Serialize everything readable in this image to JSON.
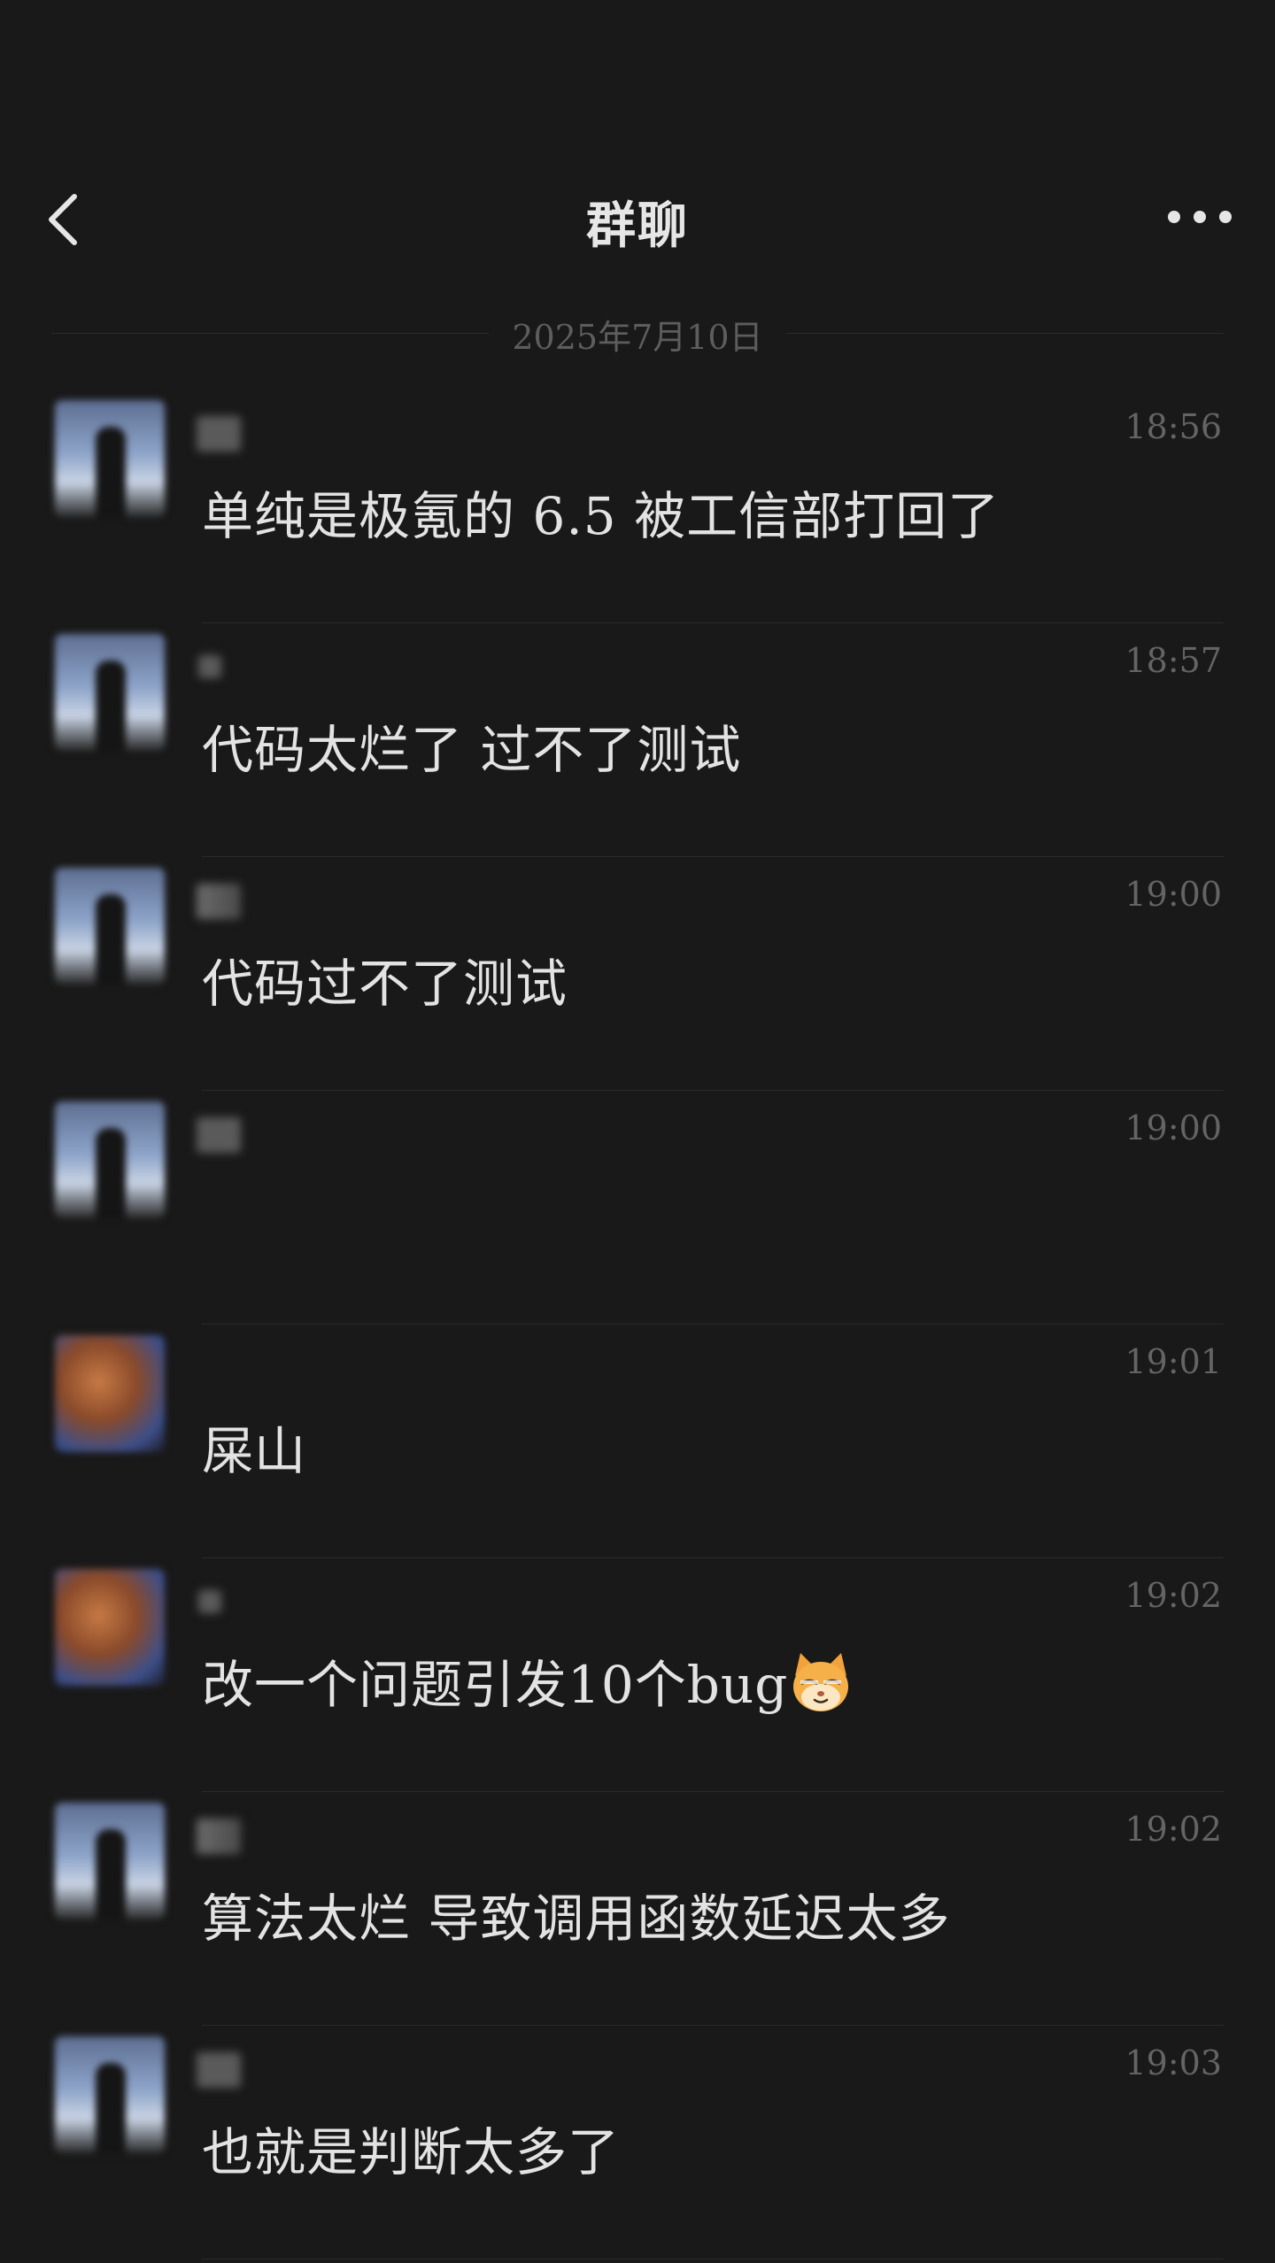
{
  "header": {
    "title": "群聊",
    "back_icon": "chevron-left-icon",
    "more_icon": "more-dots-icon"
  },
  "date_divider": "2025年7月10日",
  "messages": [
    {
      "time": "18:56",
      "text": "单纯是极氪的 6.5 被工信部打回了",
      "avatar": "sky",
      "sender_style": "normal"
    },
    {
      "time": "18:57",
      "text": "代码太烂了 过不了测试",
      "avatar": "sky",
      "sender_style": "small"
    },
    {
      "time": "19:00",
      "text": "代码过不了测试",
      "avatar": "sky",
      "sender_style": "half"
    },
    {
      "time": "19:00",
      "text": "",
      "avatar": "sky",
      "sender_style": "normal"
    },
    {
      "time": "19:01",
      "text": "屎山",
      "avatar": "warm",
      "sender_style": "none"
    },
    {
      "time": "19:02",
      "text": "改一个问题引发10个bug",
      "avatar": "warm",
      "sender_style": "small",
      "emoji": "cat-face-emoji"
    },
    {
      "time": "19:02",
      "text": "算法太烂 导致调用函数延迟太多",
      "avatar": "sky",
      "sender_style": "half"
    },
    {
      "time": "19:03",
      "text": "也就是判断太多了",
      "avatar": "sky",
      "sender_style": "normal"
    }
  ],
  "colors": {
    "background": "#191919",
    "text_primary": "#e3e3e3",
    "text_muted": "#646464",
    "divider": "#2a2a2a"
  }
}
